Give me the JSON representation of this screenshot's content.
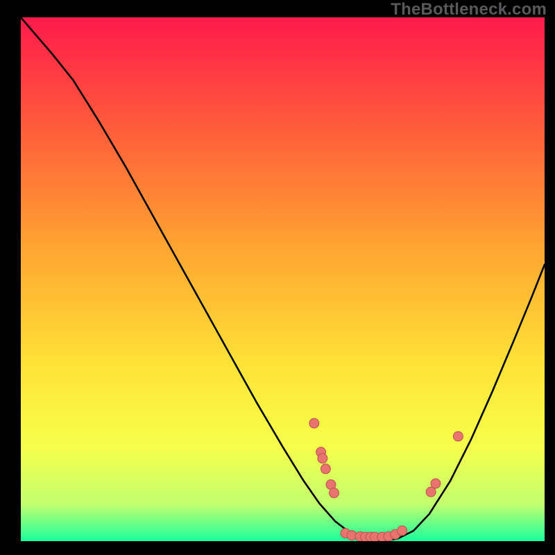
{
  "watermark": "TheBottleneck.com",
  "colors": {
    "grad_top": "#ff1a4b",
    "grad_1": "#ff5f3a",
    "grad_2": "#ffa531",
    "grad_3": "#ffe236",
    "grad_4": "#f6ff4a",
    "grad_5": "#c2ff6e",
    "grad_bottom": "#19ff9e",
    "bg": "#000000",
    "curve": "#000000",
    "dot_fill": "#e9736d",
    "dot_stroke": "#b8544f"
  },
  "chart_data": {
    "type": "line",
    "title": "",
    "xlabel": "",
    "ylabel": "",
    "xlim": [
      0,
      1
    ],
    "ylim": [
      0,
      1
    ],
    "curve": [
      {
        "x": 0.0,
        "y": 1.0
      },
      {
        "x": 0.03,
        "y": 0.965
      },
      {
        "x": 0.06,
        "y": 0.93
      },
      {
        "x": 0.1,
        "y": 0.88
      },
      {
        "x": 0.15,
        "y": 0.8
      },
      {
        "x": 0.2,
        "y": 0.715
      },
      {
        "x": 0.25,
        "y": 0.625
      },
      {
        "x": 0.3,
        "y": 0.535
      },
      {
        "x": 0.35,
        "y": 0.445
      },
      {
        "x": 0.4,
        "y": 0.355
      },
      {
        "x": 0.45,
        "y": 0.265
      },
      {
        "x": 0.5,
        "y": 0.18
      },
      {
        "x": 0.54,
        "y": 0.115
      },
      {
        "x": 0.57,
        "y": 0.072
      },
      {
        "x": 0.6,
        "y": 0.038
      },
      {
        "x": 0.63,
        "y": 0.015
      },
      {
        "x": 0.66,
        "y": 0.003
      },
      {
        "x": 0.69,
        "y": 0.0
      },
      {
        "x": 0.72,
        "y": 0.005
      },
      {
        "x": 0.75,
        "y": 0.02
      },
      {
        "x": 0.78,
        "y": 0.052
      },
      {
        "x": 0.82,
        "y": 0.115
      },
      {
        "x": 0.86,
        "y": 0.195
      },
      {
        "x": 0.9,
        "y": 0.285
      },
      {
        "x": 0.94,
        "y": 0.38
      },
      {
        "x": 0.975,
        "y": 0.465
      },
      {
        "x": 1.0,
        "y": 0.528
      }
    ],
    "dots": [
      {
        "x": 0.56,
        "y": 0.225
      },
      {
        "x": 0.573,
        "y": 0.17
      },
      {
        "x": 0.576,
        "y": 0.158
      },
      {
        "x": 0.582,
        "y": 0.138
      },
      {
        "x": 0.592,
        "y": 0.108
      },
      {
        "x": 0.598,
        "y": 0.092
      },
      {
        "x": 0.62,
        "y": 0.015
      },
      {
        "x": 0.632,
        "y": 0.011
      },
      {
        "x": 0.648,
        "y": 0.009
      },
      {
        "x": 0.658,
        "y": 0.008
      },
      {
        "x": 0.668,
        "y": 0.008
      },
      {
        "x": 0.676,
        "y": 0.008
      },
      {
        "x": 0.69,
        "y": 0.008
      },
      {
        "x": 0.702,
        "y": 0.009
      },
      {
        "x": 0.715,
        "y": 0.013
      },
      {
        "x": 0.728,
        "y": 0.02
      },
      {
        "x": 0.783,
        "y": 0.094
      },
      {
        "x": 0.792,
        "y": 0.11
      },
      {
        "x": 0.835,
        "y": 0.2
      }
    ],
    "dot_radius": 7
  }
}
